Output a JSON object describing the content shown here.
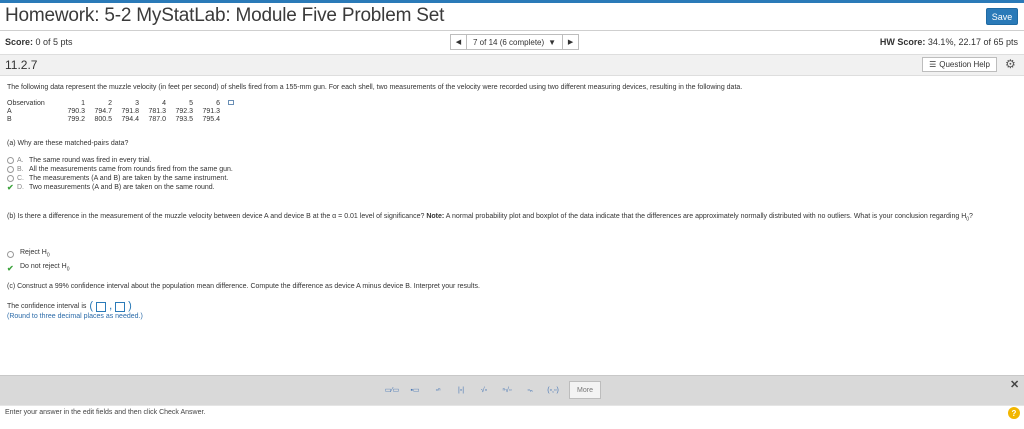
{
  "header": {
    "title": "Homework: 5-2 MyStatLab: Module Five Problem Set",
    "save_label": "Save"
  },
  "scorebar": {
    "score_label": "Score:",
    "score_value": "0 of 5 pts",
    "nav_text": "7 of 14 (6 complete)",
    "hw_score_label": "HW Score:",
    "hw_score_value": "34.1%, 22.17 of 65 pts"
  },
  "question": {
    "number": "11.2.7",
    "help_label": "Question Help",
    "intro": "The following data represent the muzzle velocity (in feet per second) of shells fired from a 155-mm gun. For each shell, two measurements of the velocity were recorded using two different measuring devices, resulting in the following data.",
    "table": {
      "header_label": "Observation",
      "columns": [
        "1",
        "2",
        "3",
        "4",
        "5",
        "6"
      ],
      "rows": [
        {
          "label": "A",
          "values": [
            "790.3",
            "794.7",
            "791.8",
            "781.3",
            "792.3",
            "791.3"
          ]
        },
        {
          "label": "B",
          "values": [
            "799.2",
            "800.5",
            "794.4",
            "787.0",
            "793.5",
            "795.4"
          ]
        }
      ]
    },
    "part_a": "(a) Why are these matched-pairs data?",
    "choices": [
      {
        "letter": "A.",
        "text": "The same round was fired in every trial.",
        "selected": false
      },
      {
        "letter": "B.",
        "text": "All the measurements came from rounds fired from the same gun.",
        "selected": false
      },
      {
        "letter": "C.",
        "text": "The measurements (A and B) are taken by the same instrument.",
        "selected": false
      },
      {
        "letter": "D.",
        "text": "Two measurements (A and B) are taken on the same round.",
        "selected": true
      }
    ],
    "part_b_pre": "(b) Is there a difference in the measurement of the muzzle velocity between device A and device B at the α = 0.01 level of significance?",
    "part_b_note_label": "Note:",
    "part_b_post": "A normal probability plot and boxplot of the data indicate that the differences are approximately normally distributed with no outliers. What is your conclusion regarding H",
    "part_b_tail": "?",
    "h_sub": "0",
    "part_b_choices": [
      {
        "text": "Reject H",
        "selected": false
      },
      {
        "text": "Do not reject H",
        "selected": true
      }
    ],
    "part_c": "(c) Construct a 99% confidence interval about the population mean difference. Compute the difference as device A minus device B. Interpret your results.",
    "ci_label": "The confidence interval is",
    "round_note": "(Round to three decimal places as needed.)"
  },
  "toolbar": {
    "more_label": "More"
  },
  "footer": {
    "instruction": "Enter your answer in the edit fields and then click Check Answer."
  }
}
